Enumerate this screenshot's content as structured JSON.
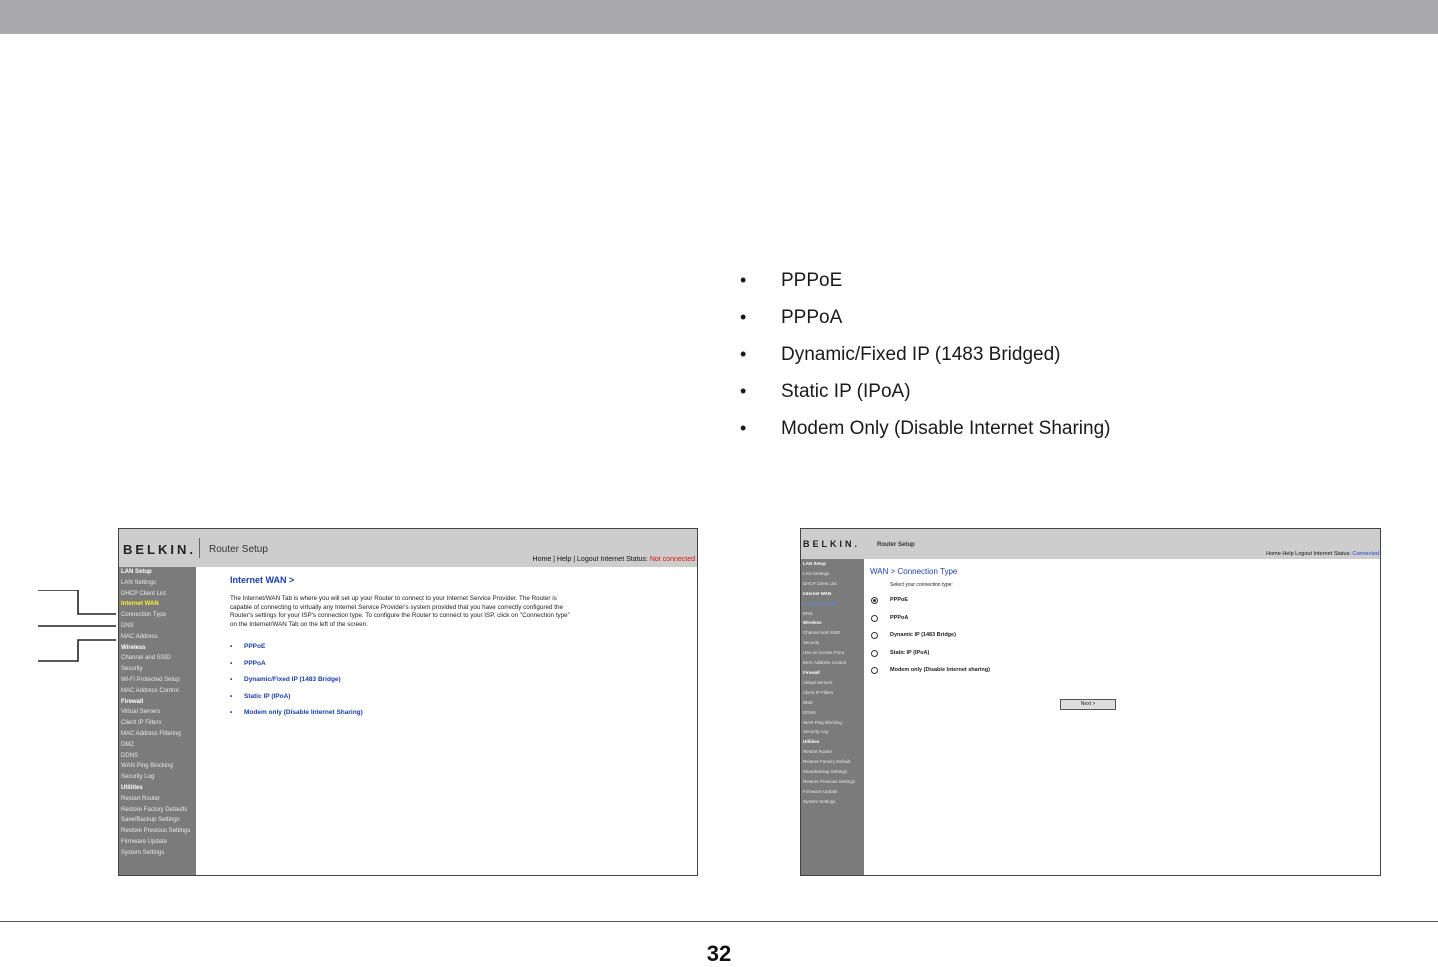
{
  "bullets": [
    "PPPoE",
    "PPPoA",
    "Dynamic/Fixed IP (1483 Bridged)",
    "Static IP (IPoA)",
    "Modem Only (Disable Internet Sharing)"
  ],
  "page_number": "32",
  "screenshot_left": {
    "logo": "BELKIN.",
    "title": "Router Setup",
    "nav": "Home | Help | Logout",
    "status_label": "Internet Status:",
    "status_value": "Not connected",
    "sidebar": [
      {
        "label": "LAN Setup",
        "kind": "section"
      },
      {
        "label": "LAN Settings",
        "kind": "item"
      },
      {
        "label": "DHCP Client List",
        "kind": "item"
      },
      {
        "label": "Internet WAN",
        "kind": "highlight"
      },
      {
        "label": "Connection Type",
        "kind": "item"
      },
      {
        "label": "DNS",
        "kind": "item"
      },
      {
        "label": "MAC Address",
        "kind": "item"
      },
      {
        "label": "Wireless",
        "kind": "section"
      },
      {
        "label": "Channel and SSID",
        "kind": "item"
      },
      {
        "label": "Security",
        "kind": "item"
      },
      {
        "label": "Wi-Fi Protected Setup",
        "kind": "item"
      },
      {
        "label": "MAC Address Control",
        "kind": "item"
      },
      {
        "label": "Firewall",
        "kind": "section"
      },
      {
        "label": "Virtual Servers",
        "kind": "item"
      },
      {
        "label": "Client IP Filters",
        "kind": "item"
      },
      {
        "label": "MAC Address Filtering",
        "kind": "item"
      },
      {
        "label": "DMZ",
        "kind": "item"
      },
      {
        "label": "DDNS",
        "kind": "item"
      },
      {
        "label": "WAN Ping Blocking",
        "kind": "item"
      },
      {
        "label": "Security Log",
        "kind": "item"
      },
      {
        "label": "Utilities",
        "kind": "section"
      },
      {
        "label": "Restart Router",
        "kind": "item"
      },
      {
        "label": "Restore Factory Defaults",
        "kind": "item"
      },
      {
        "label": "Save/Backup Settings",
        "kind": "item"
      },
      {
        "label": "Restore Previous Settings",
        "kind": "item"
      },
      {
        "label": "Firmware Update",
        "kind": "item"
      },
      {
        "label": "System Settings",
        "kind": "item"
      }
    ],
    "heading": "Internet WAN >",
    "paragraph": "The Internet/WAN Tab is where you will set up your Router to connect to your Internet Service Provider. The Router is capable of connecting to virtually any Internet Service Provider's system provided that you have correctly configured the Router's settings for your ISP's connection type. To configure the Router to connect to your ISP, click on \"Connection type\" on the Internet/WAN Tab on the left of the screen.",
    "options": [
      "PPPoE",
      "PPPoA",
      "Dynamic/Fixed IP (1483 Bridge)",
      "Static IP (IPoA)",
      "Modem only (Disable Internet Sharing)"
    ]
  },
  "screenshot_right": {
    "logo": "BELKIN.",
    "title": "Router Setup",
    "nav": "Home Help Logout",
    "status_label": "Internet Status:",
    "status_value": "Connected",
    "sidebar": [
      {
        "label": "LAN Setup",
        "kind": "section"
      },
      {
        "label": "LAN Settings",
        "kind": "item"
      },
      {
        "label": "DHCP Client List",
        "kind": "item"
      },
      {
        "label": "Internet WAN",
        "kind": "section"
      },
      {
        "label": "Connection Type",
        "kind": "highlight2"
      },
      {
        "label": "DNS",
        "kind": "item"
      },
      {
        "label": "Wireless",
        "kind": "section"
      },
      {
        "label": "Channel and SSID",
        "kind": "item"
      },
      {
        "label": "Security",
        "kind": "item"
      },
      {
        "label": "Use as Access Point",
        "kind": "item"
      },
      {
        "label": "MAC Address Control",
        "kind": "item"
      },
      {
        "label": "Firewall",
        "kind": "section"
      },
      {
        "label": "Virtual Servers",
        "kind": "item"
      },
      {
        "label": "Client IP Filters",
        "kind": "item"
      },
      {
        "label": "DMZ",
        "kind": "item"
      },
      {
        "label": "DDNS",
        "kind": "item"
      },
      {
        "label": "WAN Ping Blocking",
        "kind": "item"
      },
      {
        "label": "Security Log",
        "kind": "item"
      },
      {
        "label": "Utilities",
        "kind": "section"
      },
      {
        "label": "Restart Router",
        "kind": "item"
      },
      {
        "label": "Restore Factory Default",
        "kind": "item"
      },
      {
        "label": "Save/Backup Settings",
        "kind": "item"
      },
      {
        "label": "Restore Previous Settings",
        "kind": "item"
      },
      {
        "label": "Firmware Update",
        "kind": "item"
      },
      {
        "label": "System Settings",
        "kind": "item"
      }
    ],
    "heading": "WAN > Connection Type",
    "instruction": "Select your connection type:",
    "options": [
      "PPPoE",
      "PPPoA",
      "Dynamic IP (1483 Bridge)",
      "Static IP (IPoA)",
      "Modem only (Disable Internet sharing)"
    ],
    "selected_index": 0,
    "next_label": "Next >"
  }
}
